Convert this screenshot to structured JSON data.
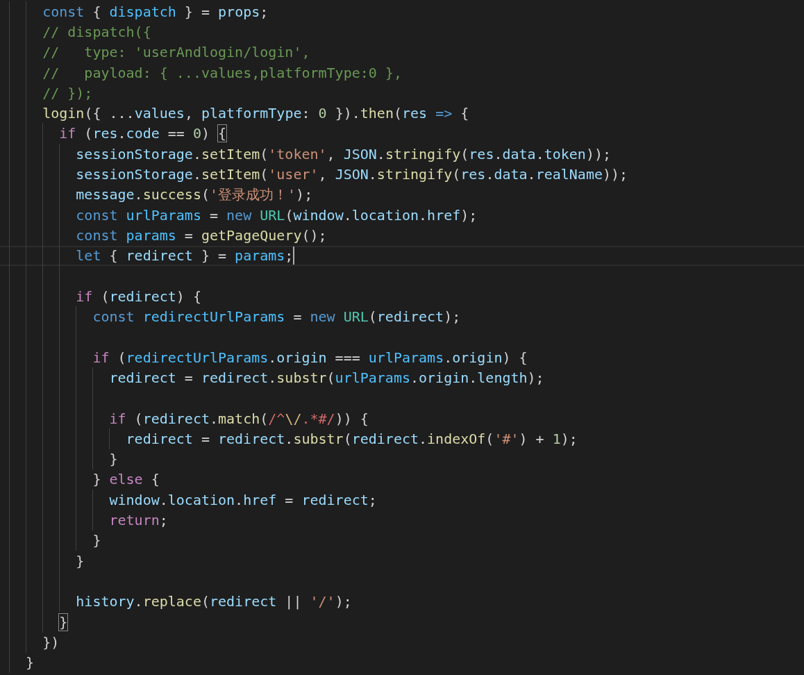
{
  "editor": {
    "lines": [
      {
        "current": false,
        "tokens": [
          {
            "kind": "kw",
            "text": "    const"
          },
          {
            "kind": "p",
            "text": " { "
          },
          {
            "kind": "cst",
            "text": "dispatch"
          },
          {
            "kind": "p",
            "text": " } = "
          },
          {
            "kind": "var",
            "text": "props"
          },
          {
            "kind": "p",
            "text": ";"
          }
        ]
      },
      {
        "current": false,
        "tokens": [
          {
            "kind": "cmt",
            "text": "    // dispatch({"
          }
        ]
      },
      {
        "current": false,
        "tokens": [
          {
            "kind": "cmt",
            "text": "    //   type: 'userAndlogin/login',"
          }
        ]
      },
      {
        "current": false,
        "tokens": [
          {
            "kind": "cmt",
            "text": "    //   payload: { ...values,platformType:0 },"
          }
        ]
      },
      {
        "current": false,
        "tokens": [
          {
            "kind": "cmt",
            "text": "    // });"
          }
        ]
      },
      {
        "current": false,
        "tokens": [
          {
            "kind": "fn",
            "text": "    login"
          },
          {
            "kind": "p",
            "text": "({ ..."
          },
          {
            "kind": "var",
            "text": "values"
          },
          {
            "kind": "p",
            "text": ", "
          },
          {
            "kind": "var",
            "text": "platformType"
          },
          {
            "kind": "p",
            "text": ": "
          },
          {
            "kind": "num",
            "text": "0"
          },
          {
            "kind": "p",
            "text": " })."
          },
          {
            "kind": "fn",
            "text": "then"
          },
          {
            "kind": "p",
            "text": "("
          },
          {
            "kind": "var",
            "text": "res"
          },
          {
            "kind": "kw",
            "text": " =>"
          },
          {
            "kind": "p",
            "text": " {"
          }
        ]
      },
      {
        "current": false,
        "tokens": [
          {
            "kind": "ctl",
            "text": "      if"
          },
          {
            "kind": "p",
            "text": " ("
          },
          {
            "kind": "var",
            "text": "res"
          },
          {
            "kind": "p",
            "text": "."
          },
          {
            "kind": "var",
            "text": "code"
          },
          {
            "kind": "p",
            "text": " == "
          },
          {
            "kind": "num",
            "text": "0"
          },
          {
            "kind": "p",
            "text": ") "
          },
          {
            "kind": "match",
            "text": "{"
          }
        ]
      },
      {
        "current": false,
        "tokens": [
          {
            "kind": "var",
            "text": "        sessionStorage"
          },
          {
            "kind": "p",
            "text": "."
          },
          {
            "kind": "fn",
            "text": "setItem"
          },
          {
            "kind": "p",
            "text": "("
          },
          {
            "kind": "str",
            "text": "'token'"
          },
          {
            "kind": "p",
            "text": ", "
          },
          {
            "kind": "var",
            "text": "JSON"
          },
          {
            "kind": "p",
            "text": "."
          },
          {
            "kind": "fn",
            "text": "stringify"
          },
          {
            "kind": "p",
            "text": "("
          },
          {
            "kind": "var",
            "text": "res"
          },
          {
            "kind": "p",
            "text": "."
          },
          {
            "kind": "var",
            "text": "data"
          },
          {
            "kind": "p",
            "text": "."
          },
          {
            "kind": "var",
            "text": "token"
          },
          {
            "kind": "p",
            "text": "));"
          }
        ]
      },
      {
        "current": false,
        "tokens": [
          {
            "kind": "var",
            "text": "        sessionStorage"
          },
          {
            "kind": "p",
            "text": "."
          },
          {
            "kind": "fn",
            "text": "setItem"
          },
          {
            "kind": "p",
            "text": "("
          },
          {
            "kind": "str",
            "text": "'user'"
          },
          {
            "kind": "p",
            "text": ", "
          },
          {
            "kind": "var",
            "text": "JSON"
          },
          {
            "kind": "p",
            "text": "."
          },
          {
            "kind": "fn",
            "text": "stringify"
          },
          {
            "kind": "p",
            "text": "("
          },
          {
            "kind": "var",
            "text": "res"
          },
          {
            "kind": "p",
            "text": "."
          },
          {
            "kind": "var",
            "text": "data"
          },
          {
            "kind": "p",
            "text": "."
          },
          {
            "kind": "var",
            "text": "realName"
          },
          {
            "kind": "p",
            "text": "));"
          }
        ]
      },
      {
        "current": false,
        "tokens": [
          {
            "kind": "var",
            "text": "        message"
          },
          {
            "kind": "p",
            "text": "."
          },
          {
            "kind": "fn",
            "text": "success"
          },
          {
            "kind": "p",
            "text": "("
          },
          {
            "kind": "str",
            "text": "'登录成功！'"
          },
          {
            "kind": "p",
            "text": ");"
          }
        ]
      },
      {
        "current": false,
        "tokens": [
          {
            "kind": "kw",
            "text": "        const"
          },
          {
            "kind": "cst",
            "text": " urlParams"
          },
          {
            "kind": "p",
            "text": " = "
          },
          {
            "kind": "kw",
            "text": "new"
          },
          {
            "kind": "cls",
            "text": " URL"
          },
          {
            "kind": "p",
            "text": "("
          },
          {
            "kind": "var",
            "text": "window"
          },
          {
            "kind": "p",
            "text": "."
          },
          {
            "kind": "var",
            "text": "location"
          },
          {
            "kind": "p",
            "text": "."
          },
          {
            "kind": "var",
            "text": "href"
          },
          {
            "kind": "p",
            "text": ");"
          }
        ]
      },
      {
        "current": false,
        "tokens": [
          {
            "kind": "kw",
            "text": "        const"
          },
          {
            "kind": "cst",
            "text": " params"
          },
          {
            "kind": "p",
            "text": " = "
          },
          {
            "kind": "fn",
            "text": "getPageQuery"
          },
          {
            "kind": "p",
            "text": "();"
          }
        ]
      },
      {
        "current": true,
        "tokens": [
          {
            "kind": "kw",
            "text": "        let"
          },
          {
            "kind": "p",
            "text": " { "
          },
          {
            "kind": "var",
            "text": "redirect"
          },
          {
            "kind": "p",
            "text": " } = "
          },
          {
            "kind": "cst",
            "text": "params"
          },
          {
            "kind": "p",
            "text": ";"
          }
        ]
      },
      {
        "current": false
      },
      {
        "current": false,
        "tokens": [
          {
            "kind": "ctl",
            "text": "        if"
          },
          {
            "kind": "p",
            "text": " ("
          },
          {
            "kind": "var",
            "text": "redirect"
          },
          {
            "kind": "p",
            "text": ") {"
          }
        ]
      },
      {
        "current": false,
        "tokens": [
          {
            "kind": "kw",
            "text": "          const"
          },
          {
            "kind": "cst",
            "text": " redirectUrlParams"
          },
          {
            "kind": "p",
            "text": " = "
          },
          {
            "kind": "kw",
            "text": "new"
          },
          {
            "kind": "cls",
            "text": " URL"
          },
          {
            "kind": "p",
            "text": "("
          },
          {
            "kind": "var",
            "text": "redirect"
          },
          {
            "kind": "p",
            "text": ");"
          }
        ]
      },
      {
        "current": false
      },
      {
        "current": false,
        "tokens": [
          {
            "kind": "ctl",
            "text": "          if"
          },
          {
            "kind": "p",
            "text": " ("
          },
          {
            "kind": "cst",
            "text": "redirectUrlParams"
          },
          {
            "kind": "p",
            "text": "."
          },
          {
            "kind": "var",
            "text": "origin"
          },
          {
            "kind": "p",
            "text": " === "
          },
          {
            "kind": "cst",
            "text": "urlParams"
          },
          {
            "kind": "p",
            "text": "."
          },
          {
            "kind": "var",
            "text": "origin"
          },
          {
            "kind": "p",
            "text": ") {"
          }
        ]
      },
      {
        "current": false,
        "tokens": [
          {
            "kind": "var",
            "text": "            redirect"
          },
          {
            "kind": "p",
            "text": " = "
          },
          {
            "kind": "var",
            "text": "redirect"
          },
          {
            "kind": "p",
            "text": "."
          },
          {
            "kind": "fn",
            "text": "substr"
          },
          {
            "kind": "p",
            "text": "("
          },
          {
            "kind": "cst",
            "text": "urlParams"
          },
          {
            "kind": "p",
            "text": "."
          },
          {
            "kind": "var",
            "text": "origin"
          },
          {
            "kind": "p",
            "text": "."
          },
          {
            "kind": "var",
            "text": "length"
          },
          {
            "kind": "p",
            "text": ");"
          }
        ]
      },
      {
        "current": false
      },
      {
        "current": false,
        "tokens": [
          {
            "kind": "ctl",
            "text": "            if"
          },
          {
            "kind": "p",
            "text": " ("
          },
          {
            "kind": "var",
            "text": "redirect"
          },
          {
            "kind": "p",
            "text": "."
          },
          {
            "kind": "fn",
            "text": "match"
          },
          {
            "kind": "p",
            "text": "("
          },
          {
            "kind": "re",
            "text": "/^"
          },
          {
            "kind": "esc",
            "text": "\\/"
          },
          {
            "kind": "re",
            "text": ".*#/"
          },
          {
            "kind": "p",
            "text": ")) {"
          }
        ]
      },
      {
        "current": false,
        "tokens": [
          {
            "kind": "var",
            "text": "              redirect"
          },
          {
            "kind": "p",
            "text": " = "
          },
          {
            "kind": "var",
            "text": "redirect"
          },
          {
            "kind": "p",
            "text": "."
          },
          {
            "kind": "fn",
            "text": "substr"
          },
          {
            "kind": "p",
            "text": "("
          },
          {
            "kind": "var",
            "text": "redirect"
          },
          {
            "kind": "p",
            "text": "."
          },
          {
            "kind": "fn",
            "text": "indexOf"
          },
          {
            "kind": "p",
            "text": "("
          },
          {
            "kind": "str",
            "text": "'#'"
          },
          {
            "kind": "p",
            "text": ") + "
          },
          {
            "kind": "num",
            "text": "1"
          },
          {
            "kind": "p",
            "text": ");"
          }
        ]
      },
      {
        "current": false,
        "tokens": [
          {
            "kind": "p",
            "text": "            }"
          }
        ]
      },
      {
        "current": false,
        "tokens": [
          {
            "kind": "p",
            "text": "          } "
          },
          {
            "kind": "ctl",
            "text": "else"
          },
          {
            "kind": "p",
            "text": " {"
          }
        ]
      },
      {
        "current": false,
        "tokens": [
          {
            "kind": "var",
            "text": "            window"
          },
          {
            "kind": "p",
            "text": "."
          },
          {
            "kind": "var",
            "text": "location"
          },
          {
            "kind": "p",
            "text": "."
          },
          {
            "kind": "var",
            "text": "href"
          },
          {
            "kind": "p",
            "text": " = "
          },
          {
            "kind": "var",
            "text": "redirect"
          },
          {
            "kind": "p",
            "text": ";"
          }
        ]
      },
      {
        "current": false,
        "tokens": [
          {
            "kind": "ctl",
            "text": "            return"
          },
          {
            "kind": "p",
            "text": ";"
          }
        ]
      },
      {
        "current": false,
        "tokens": [
          {
            "kind": "p",
            "text": "          }"
          }
        ]
      },
      {
        "current": false,
        "tokens": [
          {
            "kind": "p",
            "text": "        }"
          }
        ]
      },
      {
        "current": false
      },
      {
        "current": false,
        "tokens": [
          {
            "kind": "var",
            "text": "        history"
          },
          {
            "kind": "p",
            "text": "."
          },
          {
            "kind": "fn",
            "text": "replace"
          },
          {
            "kind": "p",
            "text": "("
          },
          {
            "kind": "var",
            "text": "redirect"
          },
          {
            "kind": "p",
            "text": " || "
          },
          {
            "kind": "str",
            "text": "'/'"
          },
          {
            "kind": "p",
            "text": ");"
          }
        ]
      },
      {
        "current": false,
        "tokens": [
          {
            "kind": "match",
            "text": "      }"
          }
        ]
      },
      {
        "current": false,
        "tokens": [
          {
            "kind": "p",
            "text": "    })"
          }
        ]
      },
      {
        "current": false,
        "tokens": [
          {
            "kind": "p",
            "text": "  }"
          }
        ]
      }
    ]
  }
}
